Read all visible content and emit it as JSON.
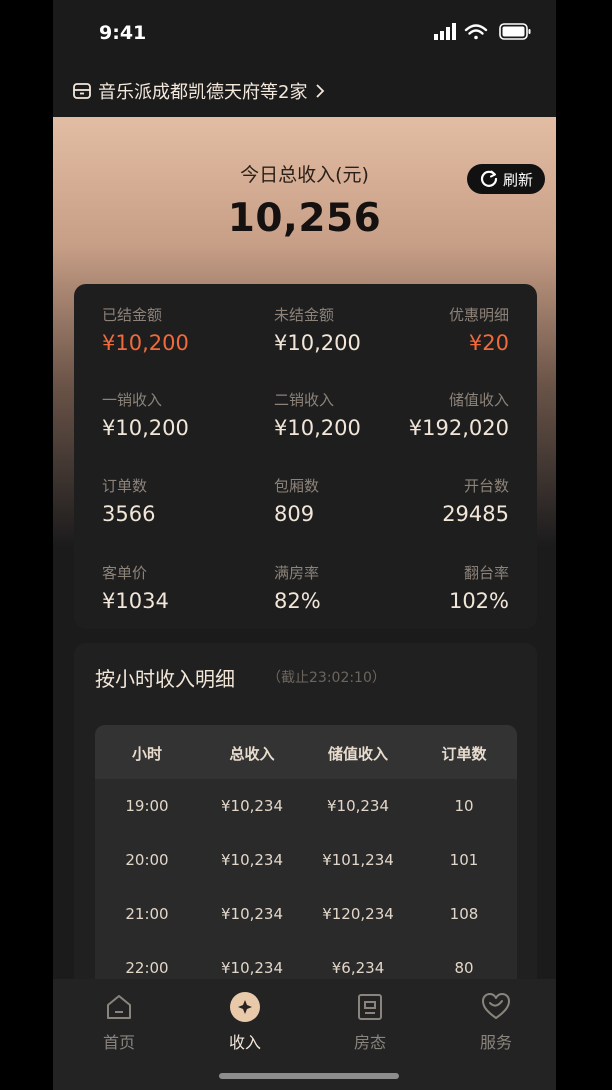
{
  "status": {
    "time": "9:41"
  },
  "store": {
    "name": "音乐派成都凯德天府等2家"
  },
  "header": {
    "label": "今日总收入(元)",
    "value": "10,256",
    "refresh_label": "刷新"
  },
  "stats": [
    {
      "label": "已结金额",
      "value": "¥10,200",
      "highlight": true
    },
    {
      "label": "未结金额",
      "value": "¥10,200",
      "highlight": false
    },
    {
      "label": "优惠明细",
      "value": "¥20",
      "highlight": true
    },
    {
      "label": "一销收入",
      "value": "¥10,200",
      "highlight": false
    },
    {
      "label": "二销收入",
      "value": "¥10,200",
      "highlight": false
    },
    {
      "label": "储值收入",
      "value": "¥192,020",
      "highlight": false
    },
    {
      "label": "订单数",
      "value": "3566",
      "highlight": false
    },
    {
      "label": "包厢数",
      "value": "809",
      "highlight": false
    },
    {
      "label": "开台数",
      "value": "29485",
      "highlight": false
    },
    {
      "label": "客单价",
      "value": "¥1034",
      "highlight": false
    },
    {
      "label": "满房率",
      "value": "82%",
      "highlight": false
    },
    {
      "label": "翻台率",
      "value": "102%",
      "highlight": false
    }
  ],
  "hourly": {
    "title": "按小时收入明细",
    "subtitle": "（截止23:02:10）",
    "columns": [
      "小时",
      "总收入",
      "储值收入",
      "订单数"
    ],
    "rows": [
      [
        "19:00",
        "¥10,234",
        "¥10,234",
        "10"
      ],
      [
        "20:00",
        "¥10,234",
        "¥101,234",
        "101"
      ],
      [
        "21:00",
        "¥10,234",
        "¥120,234",
        "108"
      ],
      [
        "22:00",
        "¥10,234",
        "¥6,234",
        "80"
      ]
    ]
  },
  "tabs": [
    {
      "label": "首页",
      "icon": "home-icon"
    },
    {
      "label": "收入",
      "icon": "income-icon",
      "active": true
    },
    {
      "label": "房态",
      "icon": "room-status-icon"
    },
    {
      "label": "服务",
      "icon": "service-icon"
    }
  ],
  "colors": {
    "accent": "#f06a3c",
    "background": "#1b1b1c"
  }
}
